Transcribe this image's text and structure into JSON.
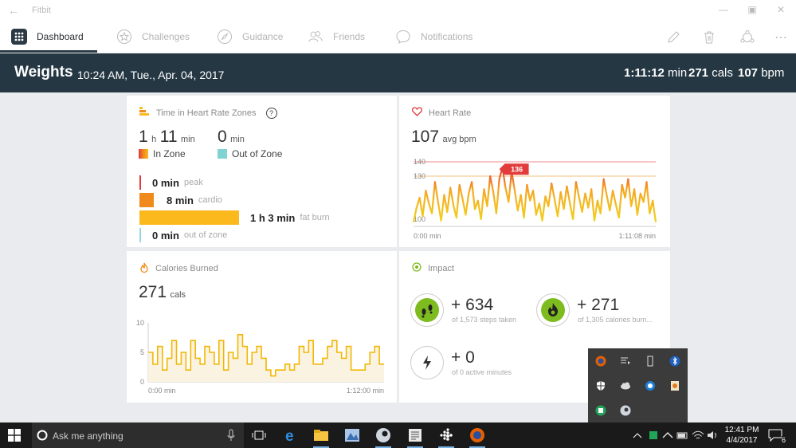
{
  "window": {
    "title": "Fitbit"
  },
  "nav": {
    "items": [
      {
        "label": "Dashboard"
      },
      {
        "label": "Challenges"
      },
      {
        "label": "Guidance"
      },
      {
        "label": "Friends"
      },
      {
        "label": "Notifications"
      }
    ]
  },
  "header": {
    "title": "Weights",
    "datetime": "10:24 AM, Tue., Apr. 04, 2017",
    "duration": "1:11:12",
    "duration_unit": "min",
    "cals": "271",
    "cals_unit": "cals",
    "bpm": "107",
    "bpm_unit": "bpm"
  },
  "zones": {
    "title": "Time in Heart Rate Zones",
    "help": "?",
    "in_zone_h": "1",
    "h_unit": "h",
    "in_zone_m": "11",
    "min_unit": "min",
    "in_zone_label": "In Zone",
    "out_zone_val": "0",
    "out_zone_label": "Out of Zone",
    "rows": [
      {
        "value": "0 min",
        "label": "peak",
        "color": "#e23b3b",
        "fraction": 0
      },
      {
        "value": "8 min",
        "label": "cardio",
        "color": "#f08a1c",
        "fraction": 0.11
      },
      {
        "value": "1 h  3 min",
        "label": "fat burn",
        "color": "#fbb91e",
        "fraction": 0.89
      },
      {
        "value": "0 min",
        "label": "out of zone",
        "color": "#9ad6e1",
        "fraction": 0
      }
    ]
  },
  "heart": {
    "title": "Heart Rate",
    "avg": "107",
    "avg_unit": "avg bpm",
    "y_labels": [
      "140",
      "130",
      "100"
    ],
    "peak_badge": "136",
    "x_start": "0:00 min",
    "x_end": "1:11:08 min"
  },
  "calories": {
    "title": "Calories Burned",
    "total": "271",
    "unit": "cals",
    "y_labels": [
      "10",
      "5",
      "0"
    ],
    "x_start": "0:00 min",
    "x_end": "1:12:00 min"
  },
  "impact": {
    "title": "Impact",
    "steps_val": "+ 634",
    "steps_sub": "of 1,573 steps taken",
    "cals_val": "+ 271",
    "cals_sub": "of 1,305 calories burn...",
    "active_val": "+ 0",
    "active_sub": "of 0 active minutes"
  },
  "taskbar": {
    "search_placeholder": "Ask me anything",
    "time": "12:41 PM",
    "date": "4/4/2017",
    "notif_count": "6"
  },
  "colors": {
    "header_bg": "#243743",
    "zone_orange": "#f08a1c",
    "zone_yellow": "#fbb91e",
    "impact_green": "#7dbb1f",
    "hr_red": "#e23b3b"
  },
  "chart_data": [
    {
      "type": "line",
      "title": "Heart Rate",
      "ylabel": "",
      "xlabel": "",
      "ylim": [
        95,
        145
      ],
      "x_labels": [
        "0:00 min",
        "1:11:08 min"
      ],
      "reference_lines": [
        140,
        130
      ],
      "peak": 136,
      "values": [
        98,
        108,
        115,
        102,
        120,
        111,
        104,
        126,
        112,
        99,
        117,
        105,
        122,
        110,
        101,
        124,
        114,
        103,
        118,
        126,
        107,
        113,
        100,
        121,
        109,
        130,
        119,
        104,
        128,
        136,
        122,
        112,
        133,
        120,
        106,
        117,
        101,
        124,
        113,
        120,
        103,
        111,
        99,
        116,
        109,
        125,
        114,
        102,
        119,
        107,
        123,
        111,
        100,
        126,
        115,
        105,
        118,
        108,
        121,
        99,
        113,
        104,
        128,
        117,
        106,
        120,
        110,
        101,
        124,
        115,
        128,
        109,
        121,
        103,
        118,
        112,
        126,
        104,
        113,
        98
      ]
    },
    {
      "type": "line",
      "title": "Calories Burned",
      "ylabel": "",
      "xlabel": "",
      "ylim": [
        0,
        10
      ],
      "x_labels": [
        "0:00 min",
        "1:12:00 min"
      ],
      "values": [
        5,
        3,
        6,
        2,
        4,
        7,
        3,
        5,
        2,
        7,
        4,
        3,
        6,
        5,
        3,
        7,
        2,
        5,
        4,
        8,
        6,
        3,
        5,
        6,
        4,
        2,
        1,
        2,
        2,
        3,
        2,
        3,
        6,
        5,
        7,
        3,
        3,
        4,
        6,
        7,
        5,
        4,
        6,
        2,
        2,
        2,
        3,
        5,
        6,
        3
      ]
    }
  ]
}
